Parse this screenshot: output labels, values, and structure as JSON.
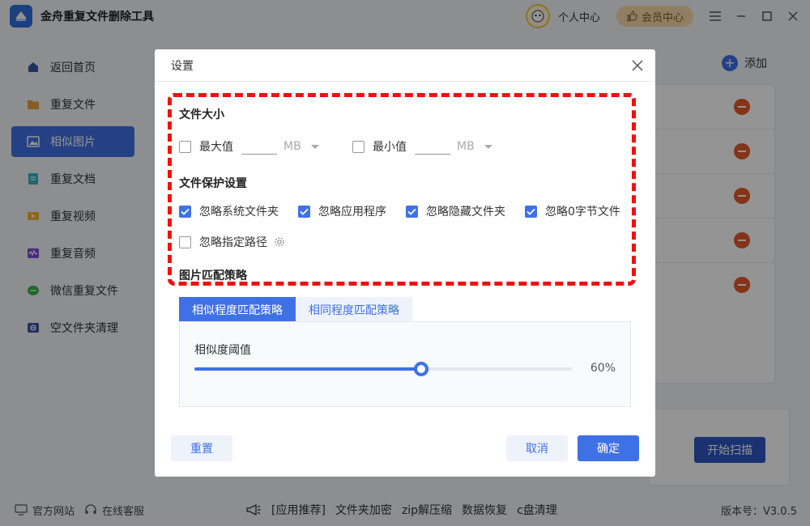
{
  "app": {
    "title": "金舟重复文件删除工具"
  },
  "titlebar": {
    "personal_center": "个人中心",
    "vip_center": "会员中心"
  },
  "sidebar": {
    "items": [
      {
        "label": "返回首页",
        "icon": "home-icon"
      },
      {
        "label": "重复文件",
        "icon": "folder-icon"
      },
      {
        "label": "相似图片",
        "icon": "image-icon",
        "active": true
      },
      {
        "label": "重复文档",
        "icon": "document-icon"
      },
      {
        "label": "重复视频",
        "icon": "video-icon"
      },
      {
        "label": "重复音频",
        "icon": "audio-icon"
      },
      {
        "label": "微信重复文件",
        "icon": "wechat-icon"
      },
      {
        "label": "空文件夹清理",
        "icon": "empty-folder-icon"
      }
    ]
  },
  "main": {
    "add_label": "添加",
    "start_scan": "开始扫描"
  },
  "dialog": {
    "title": "设置",
    "file_size": {
      "title": "文件大小",
      "max_label": "最大值",
      "max_value": "",
      "min_label": "最小值",
      "min_value": "",
      "unit": "MB"
    },
    "protection": {
      "title": "文件保护设置",
      "options": [
        {
          "label": "忽略系统文件夹",
          "checked": true
        },
        {
          "label": "忽略应用程序",
          "checked": true
        },
        {
          "label": "忽略隐藏文件夹",
          "checked": true
        },
        {
          "label": "忽略0字节文件",
          "checked": true
        },
        {
          "label": "忽略指定路径",
          "checked": false
        }
      ]
    },
    "matching": {
      "title": "图片匹配策略",
      "tabs": [
        "相似程度匹配策略",
        "相同程度匹配策略"
      ],
      "threshold_label": "相似度阈值",
      "threshold_value": 60,
      "threshold_text": "60%"
    },
    "buttons": {
      "reset": "重置",
      "cancel": "取消",
      "ok": "确定"
    }
  },
  "footer": {
    "official_site": "官方网站",
    "online_service": "在线客服",
    "recommend": "[应用推荐]",
    "links": [
      "文件夹加密",
      "zip解压缩",
      "数据恢复",
      "c盘清理"
    ],
    "version": "版本号：V3.0.5"
  },
  "colors": {
    "accent": "#3f71e6",
    "highlight": "#ee1111",
    "remove": "#e35a2a"
  }
}
